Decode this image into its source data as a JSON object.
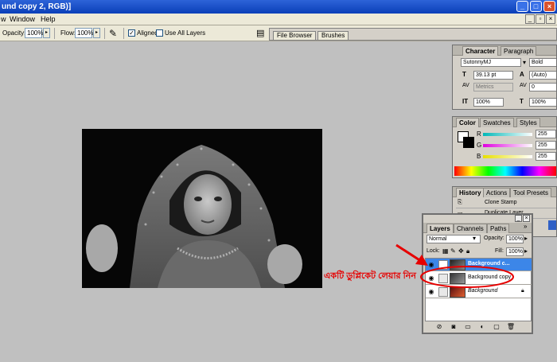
{
  "window": {
    "title": "und copy 2, RGB)]"
  },
  "menu": {
    "items": [
      "w",
      "Window",
      "Help"
    ]
  },
  "options": {
    "opacity_label": "Opacity:",
    "opacity_value": "100%",
    "flow_label": "Flow:",
    "flow_value": "100%",
    "aligned_label": "Aligned",
    "aligned_checked": "✓",
    "use_all_layers_label": "Use All Layers"
  },
  "palette_well": {
    "tabs": [
      "File Browser",
      "Brushes"
    ]
  },
  "character_panel": {
    "tabs": [
      "Character",
      "Paragraph"
    ],
    "font_family": "SutonnyMJ",
    "font_style": "Bold",
    "font_size": "39.13 pt",
    "leading": "(Auto)",
    "kerning": "Metrics",
    "tracking": "0",
    "vertical_scale": "100%",
    "horizontal_scale": "100%",
    "icons": {
      "size": "T",
      "leading": "A",
      "kerning": "AV",
      "tracking": "AV",
      "vscale": "IT",
      "hscale": "T"
    }
  },
  "color_panel": {
    "tabs": [
      "Color",
      "Swatches",
      "Styles"
    ],
    "channels": [
      {
        "label": "R",
        "value": "255"
      },
      {
        "label": "G",
        "value": "255"
      },
      {
        "label": "B",
        "value": "255"
      }
    ],
    "colors": {
      "r": "#00b8b8",
      "g": "#e000e0",
      "b": "#e8e000"
    }
  },
  "history_panel": {
    "tabs": [
      "History",
      "Actions",
      "Tool Presets"
    ],
    "items": [
      "Clone Stamp",
      "Duplicate Layer"
    ]
  },
  "layers_panel": {
    "tabs": [
      "Layers",
      "Channels",
      "Paths"
    ],
    "blend_mode": "Normal",
    "opacity_label": "Opacity:",
    "opacity_value": "100%",
    "lock_label": "Lock:",
    "fill_label": "Fill:",
    "fill_value": "100%",
    "layers": [
      "Background c...",
      "Background copy",
      "Background"
    ],
    "menu_glyph": "»"
  },
  "annotation": {
    "text": "একটি ডুপ্লিকেট লেয়ার নিন",
    "color": "#e60000"
  }
}
